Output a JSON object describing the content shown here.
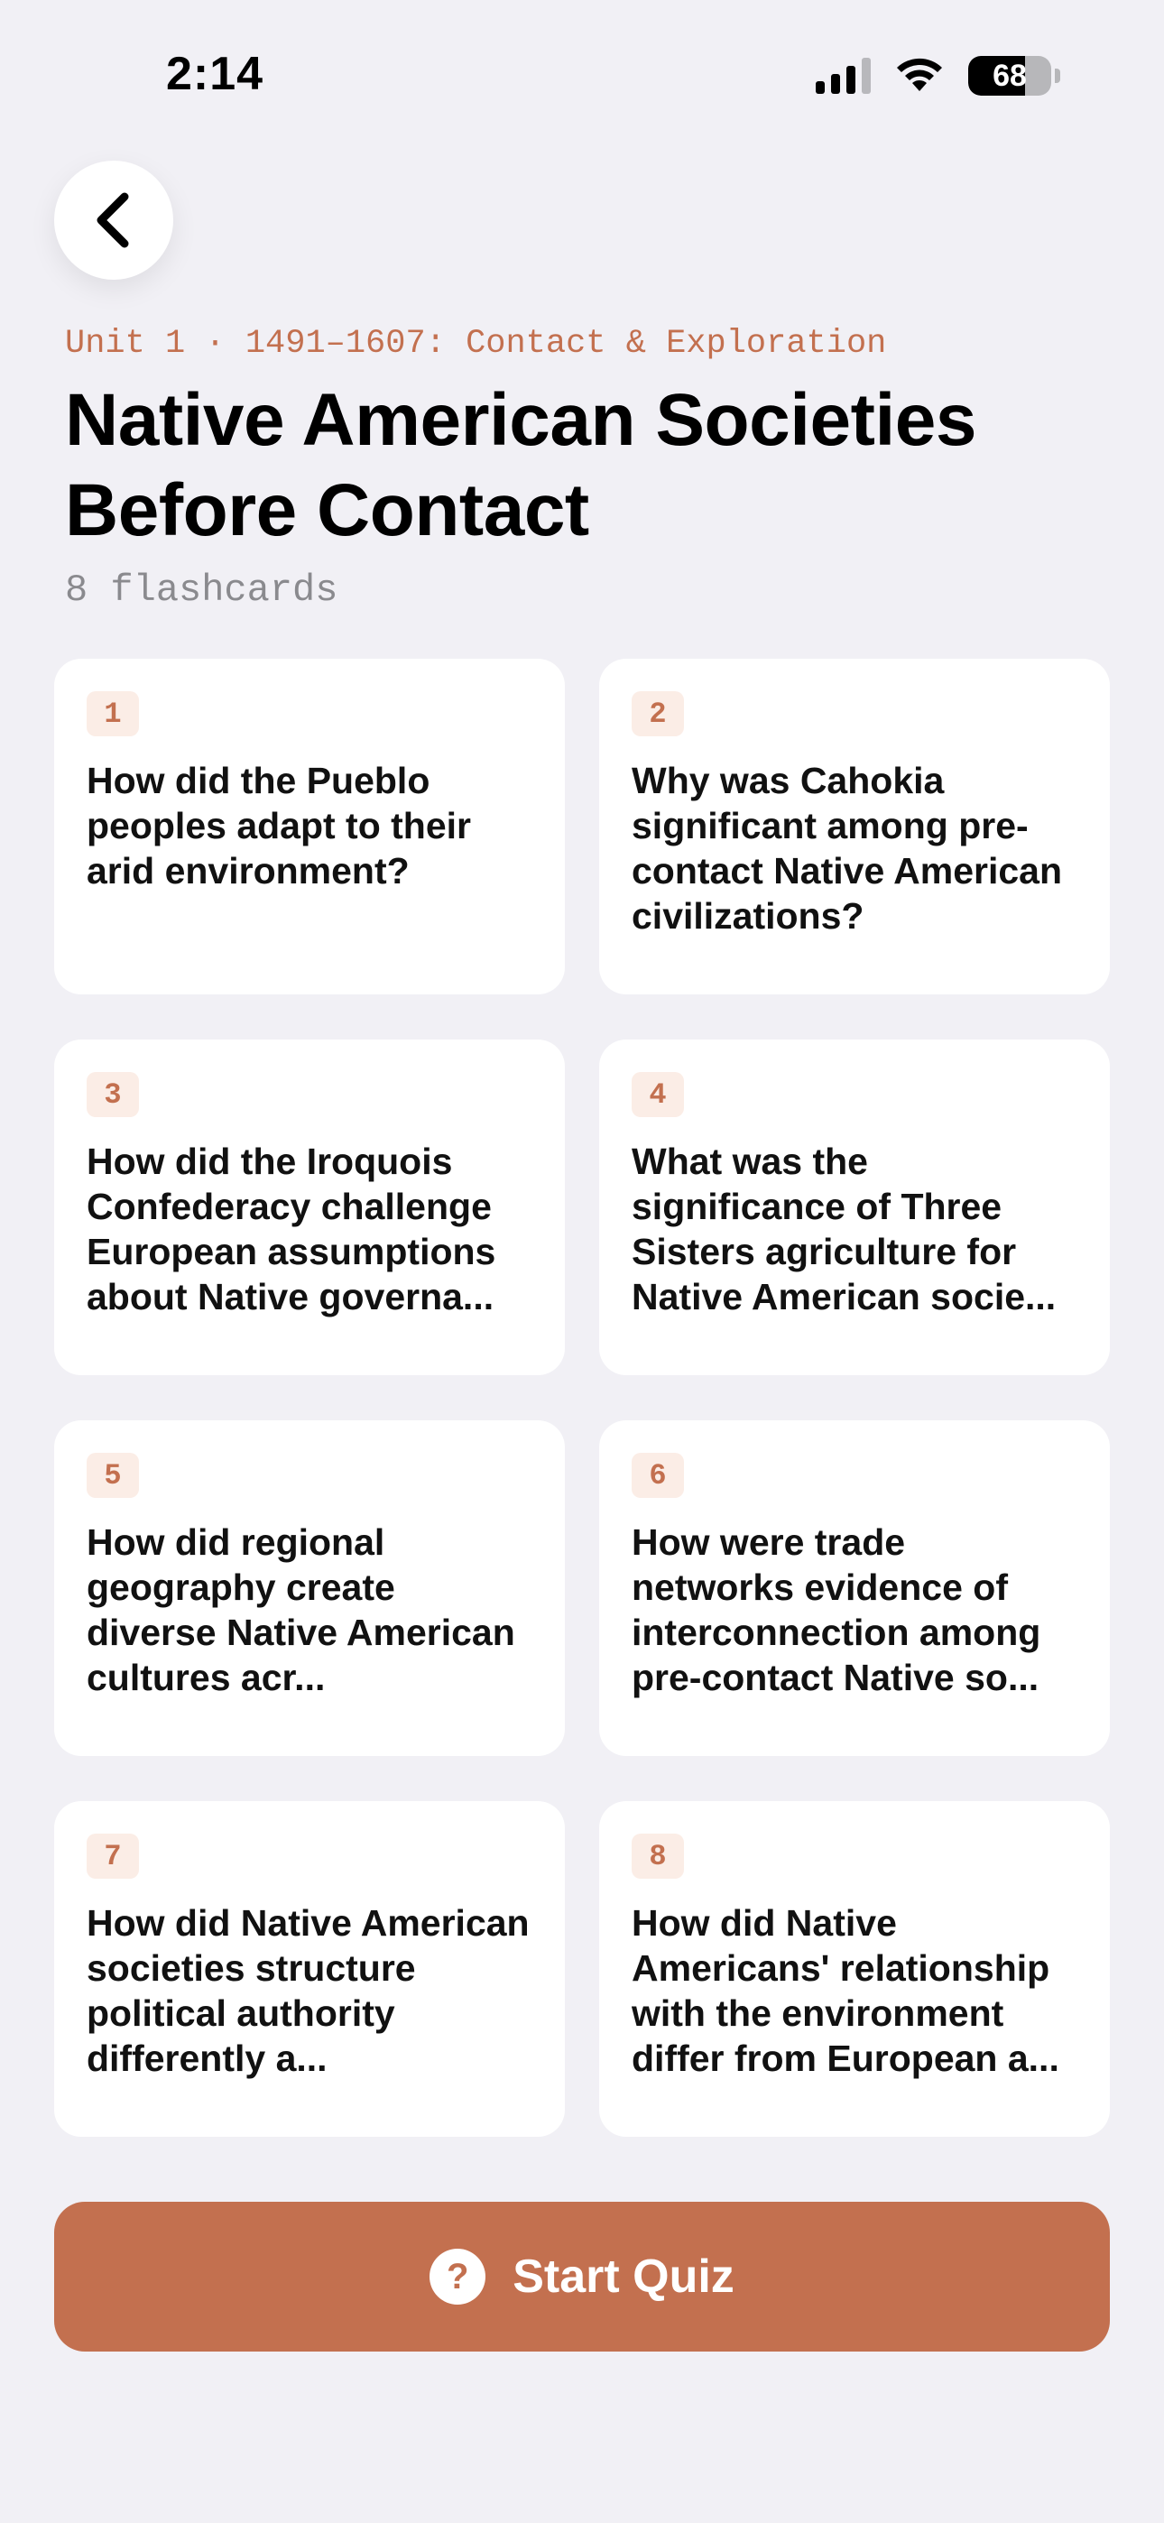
{
  "status_bar": {
    "time": "2:14",
    "battery_percent": "68",
    "battery_level": 0.68,
    "signal_bars_active": 3,
    "signal_bars_total": 4
  },
  "icons": {
    "back": "chevron-left-icon",
    "signal": "cellular-signal-icon",
    "wifi": "wifi-icon",
    "battery": "battery-icon",
    "quiz": "question-circle-icon"
  },
  "colors": {
    "accent": "#C3704F",
    "accent_soft": "#FBEDE6",
    "background": "#F1F0F5",
    "card": "#FFFFFF"
  },
  "header": {
    "eyebrow": "Unit 1 · 1491–1607: Contact & Exploration",
    "title": "Native American Societies Before Contact",
    "count": "8 flashcards"
  },
  "cards": [
    {
      "number": "1",
      "question": "How did the Pueblo peoples adapt to their arid environment?"
    },
    {
      "number": "2",
      "question": "Why was Cahokia significant among pre-contact Native American civilizations?"
    },
    {
      "number": "3",
      "question": "How did the Iroquois Confederacy challenge European assumptions about Native governa..."
    },
    {
      "number": "4",
      "question": "What was the significance of Three Sisters agriculture for Native American socie..."
    },
    {
      "number": "5",
      "question": "How did regional geography create diverse Native American cultures acr..."
    },
    {
      "number": "6",
      "question": "How were trade networks evidence of interconnection among pre-contact Native so..."
    },
    {
      "number": "7",
      "question": "How did Native American societies structure political authority differently a..."
    },
    {
      "number": "8",
      "question": "How did Native Americans' relationship with the environment differ from European a..."
    }
  ],
  "actions": {
    "quiz_icon_glyph": "?",
    "start_label": "Start Quiz"
  }
}
